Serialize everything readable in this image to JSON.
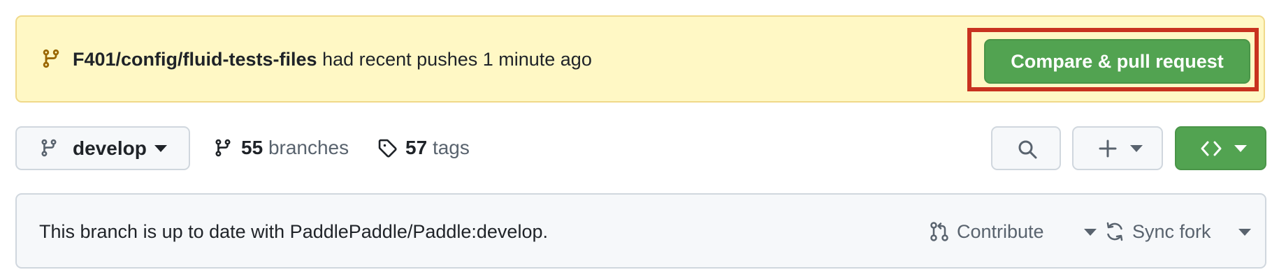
{
  "banner": {
    "branch_icon": "git-branch-icon",
    "branch_name": "F401/config/fluid-tests-files",
    "message": " had recent pushes 1 minute ago",
    "compare_button_label": "Compare & pull request"
  },
  "toolbar": {
    "branch_select": {
      "icon": "git-branch-icon",
      "current_branch": "develop",
      "caret": "chevron-down-icon"
    },
    "branches": {
      "icon": "git-branch-icon",
      "count": "55",
      "label": "branches"
    },
    "tags": {
      "icon": "tag-icon",
      "count": "57",
      "label": "tags"
    },
    "search_button": {
      "icon": "search-icon"
    },
    "add_file_button": {
      "icon": "plus-icon"
    },
    "code_button": {
      "icon": "code-icon"
    }
  },
  "fork_status": {
    "message": "This branch is up to date with PaddlePaddle/Paddle:develop.",
    "contribute_label": "Contribute",
    "sync_fork_label": "Sync fork"
  },
  "colors": {
    "banner_background": "#fff8c5",
    "banner_border": "#f0d98a",
    "branch_icon_color": "#9a6700",
    "primary_green": "#52a351",
    "highlight_red": "#c8321f",
    "muted_text": "#59636e",
    "button_background": "#f6f8fa",
    "border": "#d0d7de"
  }
}
